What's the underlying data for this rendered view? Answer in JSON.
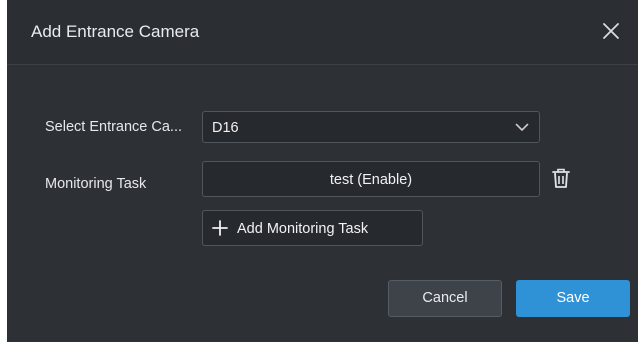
{
  "dialog": {
    "title": "Add Entrance Camera",
    "close_icon": "close-icon"
  },
  "form": {
    "camera_label": "Select Entrance Ca...",
    "camera_value": "D16",
    "dropdown_icon": "chevron-down-icon",
    "task_label": "Monitoring Task",
    "tasks": [
      {
        "label": "test (Enable)"
      }
    ],
    "delete_icon": "trash-icon",
    "add_task_label": "Add Monitoring Task",
    "add_icon": "plus-icon"
  },
  "footer": {
    "cancel_label": "Cancel",
    "save_label": "Save"
  },
  "colors": {
    "dialog_bg": "#2d3136",
    "field_bg": "#26292e",
    "primary": "#2f92d6",
    "text": "#e9ebee"
  }
}
